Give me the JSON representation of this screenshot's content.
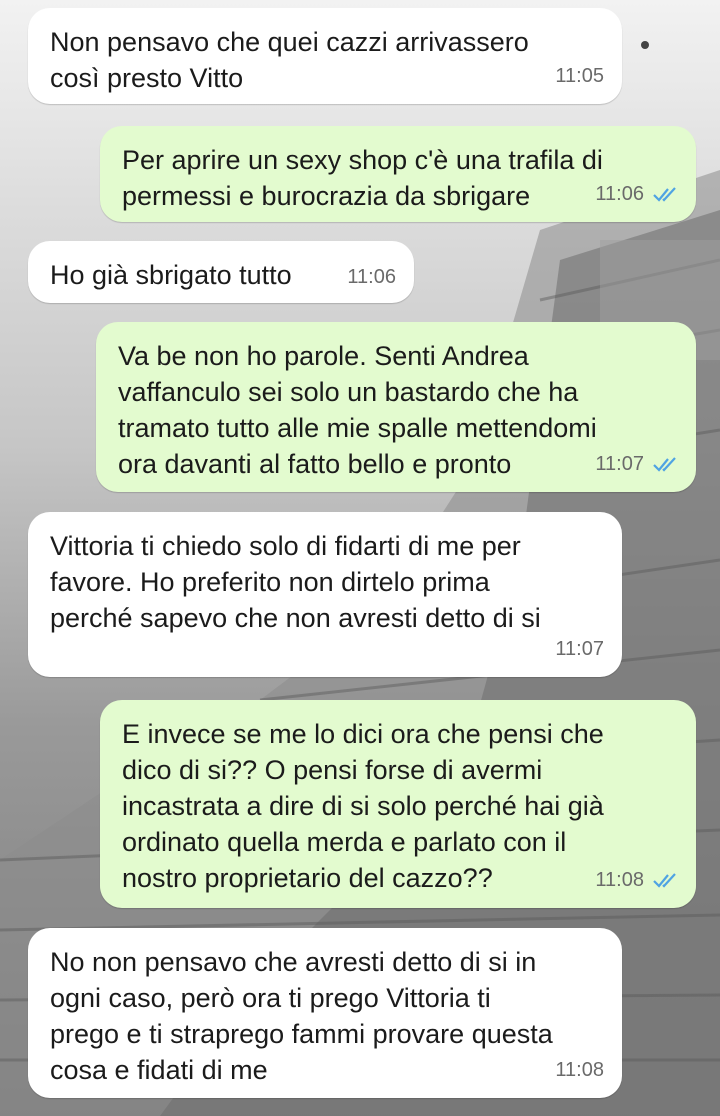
{
  "colors": {
    "incoming_bubble": "#ffffff",
    "outgoing_bubble": "#e3fbcf",
    "read_ticks": "#4fa3e3",
    "time_text": "#6a6a6a"
  },
  "messages": [
    {
      "direction": "in",
      "text": "Non pensavo che quei cazzi arrivassero\ncosì presto Vitto",
      "time": "11:05"
    },
    {
      "direction": "out",
      "text": "Per aprire un sexy shop c'è una trafila di\npermessi e burocrazia da sbrigare",
      "time": "11:06",
      "status": "read-ticks-icon"
    },
    {
      "direction": "in",
      "text": "Ho già sbrigato tutto",
      "time": "11:06"
    },
    {
      "direction": "out",
      "text": "Va be non ho parole. Senti Andrea\nvaffanculo sei solo un bastardo che ha\ntramato tutto alle mie spalle mettendomi\nora davanti al fatto bello e pronto",
      "time": "11:07",
      "status": "read-ticks-icon"
    },
    {
      "direction": "in",
      "text": "Vittoria ti chiedo solo di fidarti di me per\nfavore. Ho preferito non dirtelo prima\nperché sapevo che non avresti detto di si",
      "time": "11:07"
    },
    {
      "direction": "out",
      "text": "E invece se me lo dici ora che pensi che\ndico di si?? O pensi forse di avermi\nincastrata a dire di si solo perché hai già\nordinato quella merda e parlato con il\nnostro proprietario del cazzo??",
      "time": "11:08",
      "status": "read-ticks-icon"
    },
    {
      "direction": "in",
      "text": "No non pensavo che avresti detto di si in\nogni caso, però ora ti prego Vittoria ti\nprego e ti straprego fammi provare questa\ncosa e fidati di me",
      "time": "11:08"
    }
  ]
}
